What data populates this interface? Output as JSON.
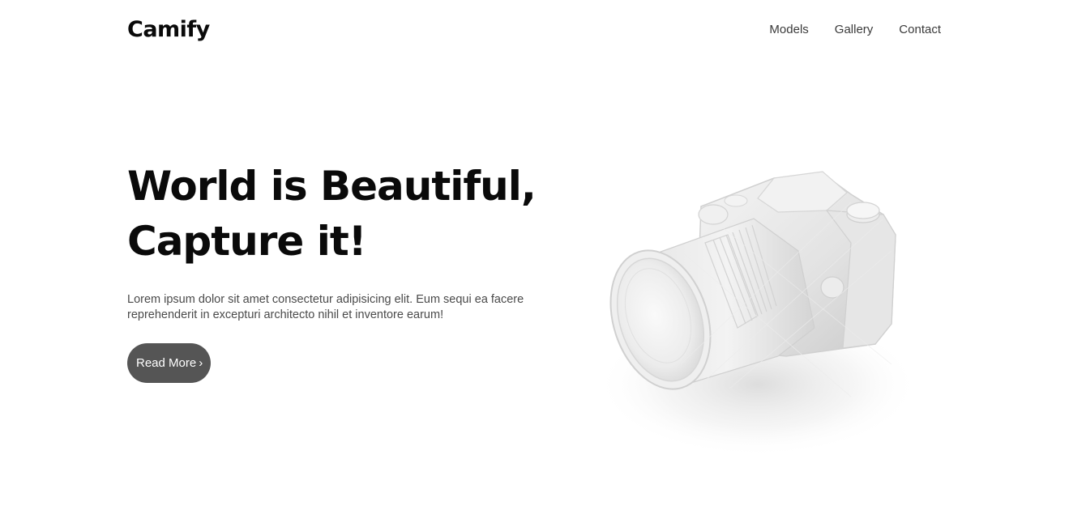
{
  "header": {
    "logo": "Camify",
    "nav": [
      {
        "label": "Models"
      },
      {
        "label": "Gallery"
      },
      {
        "label": "Contact"
      }
    ]
  },
  "hero": {
    "title_line1": "World is Beautiful,",
    "title_line2": "Capture it!",
    "description": "Lorem ipsum dolor sit amet consectetur adipisicing elit. Eum sequi ea facere reprehenderit in excepturi architecto nihil et inventore earum!",
    "cta_label": "Read More",
    "cta_icon": "chevron-right-icon"
  },
  "image": {
    "subject": "camera-illustration"
  },
  "colors": {
    "background": "#ffffff",
    "text": "#0a0a0a",
    "muted_text": "#4a4a4a",
    "button": "#555555",
    "button_text": "#ffffff"
  }
}
